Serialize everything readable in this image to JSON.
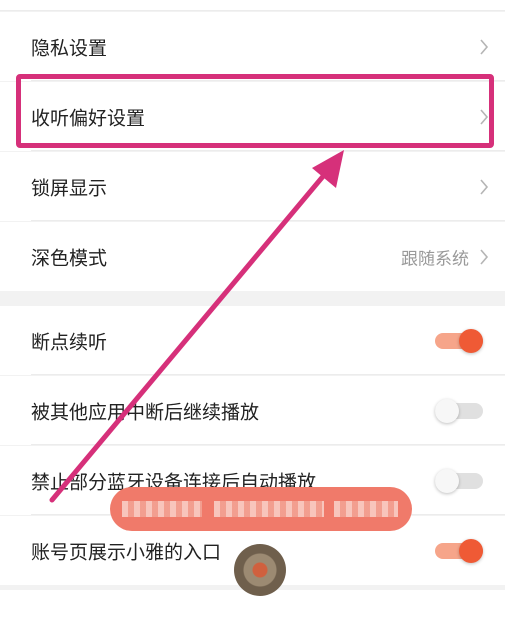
{
  "settings": {
    "privacy": "隐私设置",
    "listening_pref": "收听偏好设置",
    "lock_screen": "锁屏显示",
    "dark_mode": "深色模式",
    "dark_mode_value": "跟随系统",
    "resume_listening": "断点续听",
    "interrupt_resume": "被其他应用中断后继续播放",
    "bluetooth_autoplay": "禁止部分蓝牙设备连接后自动播放",
    "xiaoya_entry": "账号页展示小雅的入口"
  },
  "toggles": {
    "resume_listening": true,
    "interrupt_resume": false,
    "bluetooth_autoplay": false,
    "xiaoya_entry": true
  },
  "colors": {
    "accent": "#ef5a35",
    "annotation": "#d6307a"
  },
  "icons": {
    "chevron": "chevron-right-icon"
  }
}
